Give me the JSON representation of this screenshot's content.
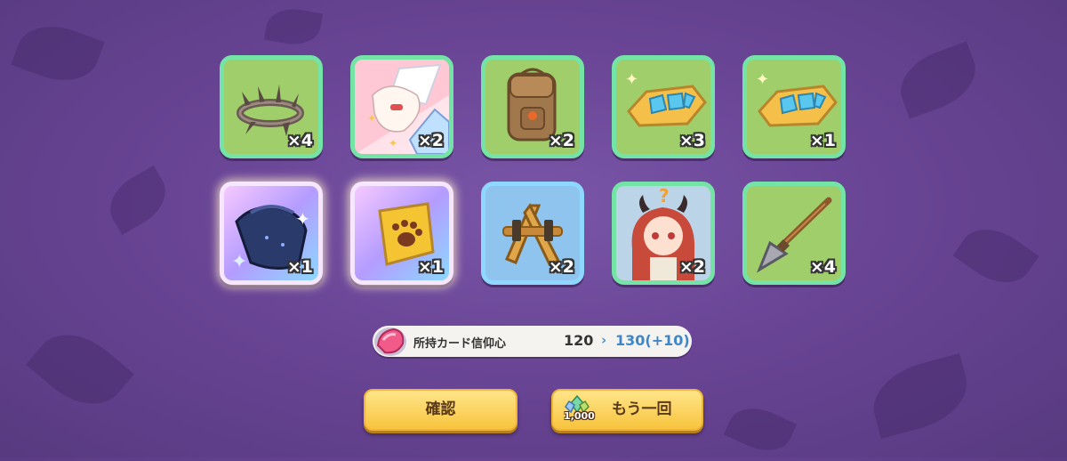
{
  "rewards": [
    {
      "item": "thorn-crown",
      "qty": "×4",
      "frame": "green"
    },
    {
      "item": "memory-fragment",
      "qty": "×2",
      "frame": "pink"
    },
    {
      "item": "leather-backpack",
      "qty": "×2",
      "frame": "green"
    },
    {
      "item": "golden-bracer",
      "qty": "×3",
      "frame": "green"
    },
    {
      "item": "golden-bracer",
      "qty": "×1",
      "frame": "green"
    },
    {
      "item": "dark-cloak",
      "qty": "×1",
      "frame": "rainbow"
    },
    {
      "item": "paw-badge",
      "qty": "×1",
      "frame": "rainbow"
    },
    {
      "item": "strap-harness",
      "qty": "×2",
      "frame": "blue"
    },
    {
      "item": "character-memory-piece",
      "qty": "×2",
      "frame": "green"
    },
    {
      "item": "spear-head",
      "qty": "×4",
      "frame": "green"
    }
  ],
  "faith_bar": {
    "label": "所持カード信仰心",
    "current": "120",
    "arrow": "›",
    "next": "130(+10)",
    "icon": "pink-gem-icon"
  },
  "buttons": {
    "confirm_label": "確認",
    "again_label": "もう一回",
    "again_cost": "1,000",
    "again_cost_icon": "crystal-icon"
  },
  "colors": {
    "background": "#6a4596",
    "frame_green": "#74e3a6",
    "frame_blue": "#8ed7ff",
    "button": "#f7c43d"
  }
}
